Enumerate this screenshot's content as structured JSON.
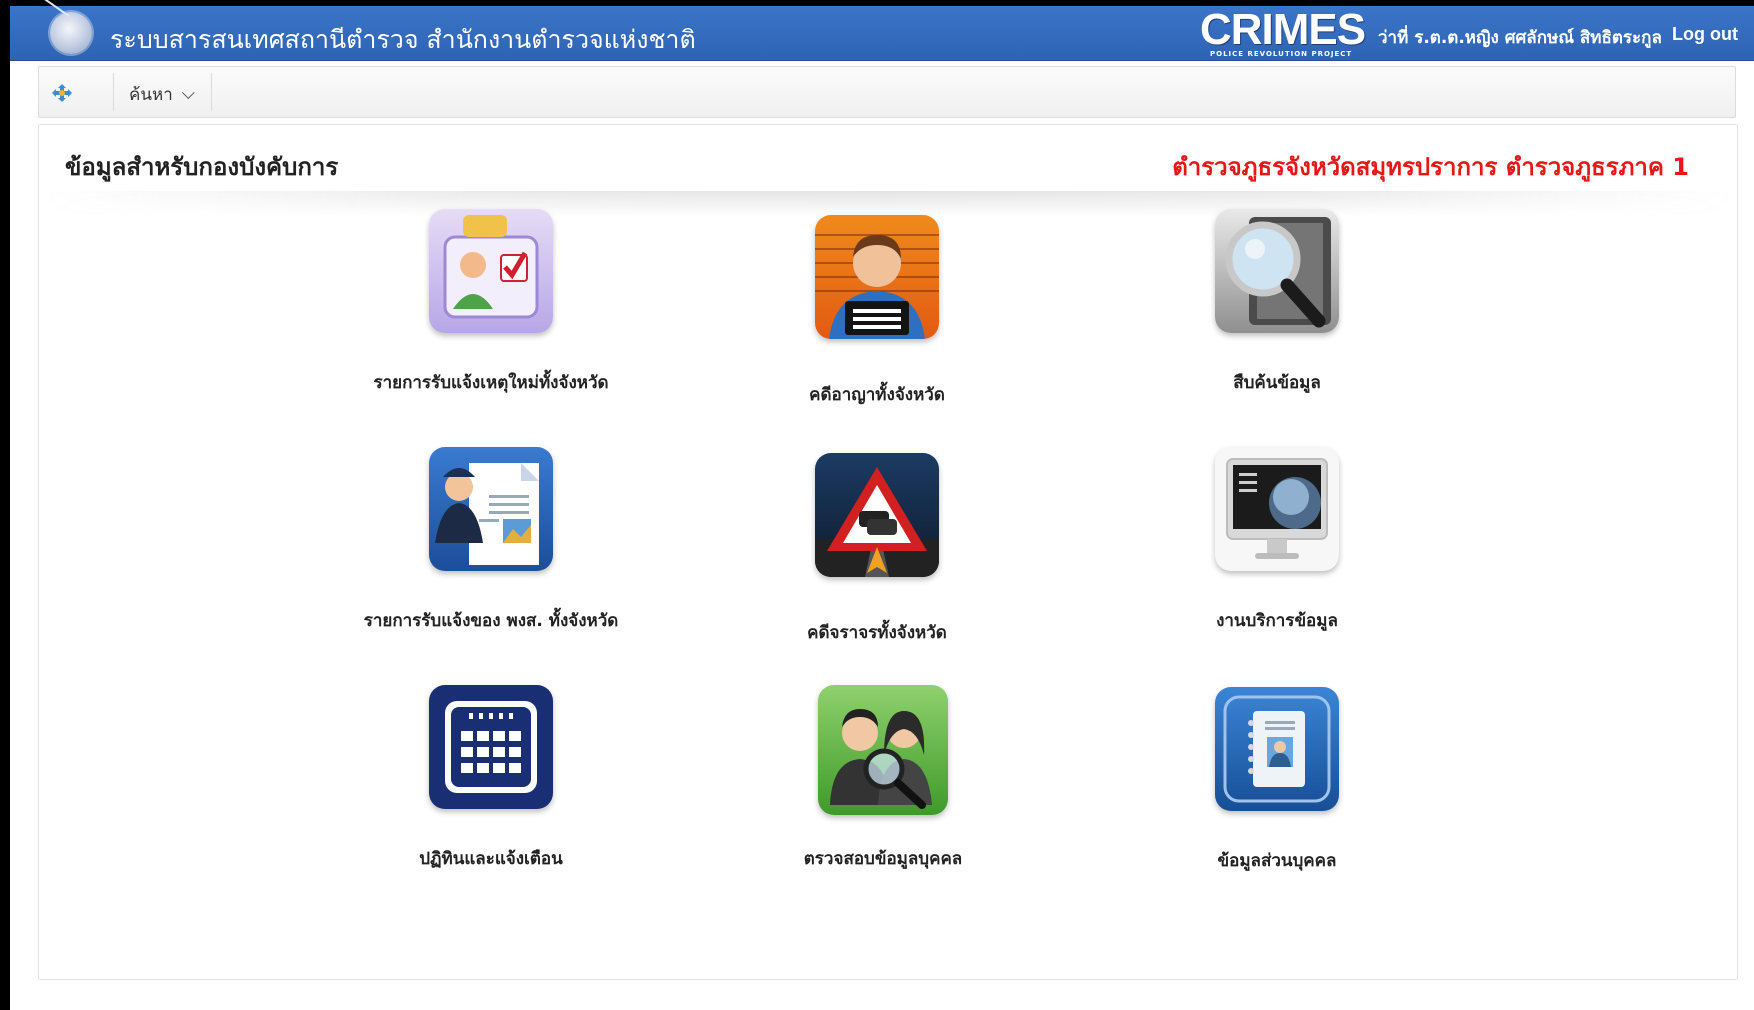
{
  "header": {
    "app_title": "ระบบสารสนเทศสถานีตำรวจ  สำนักงานตำรวจแห่งชาติ",
    "brand": "CRIMES",
    "brand_sub": "POLICE REVOLUTION PROJECT",
    "user": "ว่าที่ ร.ต.ต.หญิง ศศลักษณ์ สิทธิตระกูล",
    "logout_label": "Log out"
  },
  "nav": {
    "menu_label": "ค้นหา"
  },
  "panel": {
    "title": "ข้อมูลสำหรับกองบังคับการ",
    "region": "ตำรวจภูธรจังหวัดสมุทรปราการ ตำรวจภูธรภาค 1"
  },
  "tiles": [
    {
      "label": "รายการรับแจ้งเหตุใหม่ทั้งจังหวัด",
      "icon": "id-card-icon"
    },
    {
      "label": "คดีอาญาทั้งจังหวัด",
      "icon": "mugshot-icon"
    },
    {
      "label": "สืบค้นข้อมูล",
      "icon": "search-magnifier-icon"
    },
    {
      "label": "รายการรับแจ้งของ พงส. ทั้งจังหวัด",
      "icon": "officer-report-icon"
    },
    {
      "label": "คดีจราจรทั้งจังหวัด",
      "icon": "traffic-warning-icon"
    },
    {
      "label": "งานบริการข้อมูล",
      "icon": "computer-monitor-icon"
    },
    {
      "label": "ปฏิทินและแจ้งเตือน",
      "icon": "calendar-icon"
    },
    {
      "label": "ตรวจสอบข้อมูลบุคคล",
      "icon": "person-search-icon"
    },
    {
      "label": "ข้อมูลส่วนบุคคล",
      "icon": "address-book-icon"
    }
  ],
  "colors": {
    "header_blue": "#2e63b3",
    "region_red": "#e81717"
  }
}
